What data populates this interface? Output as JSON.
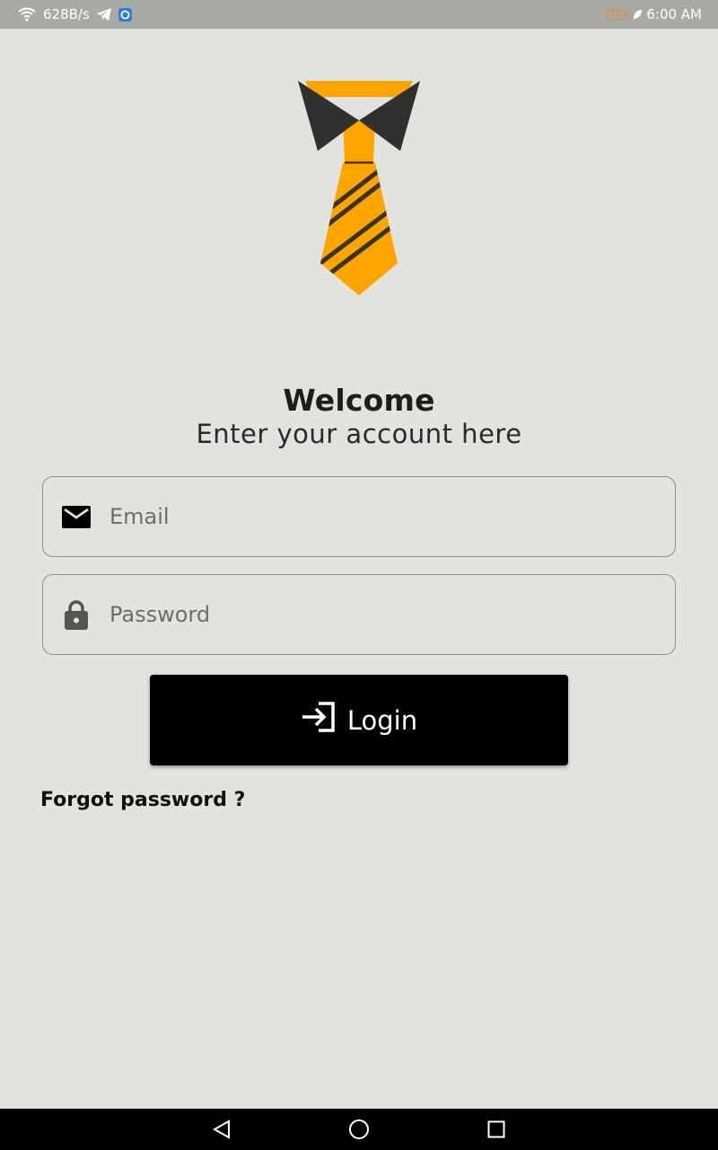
{
  "status_bar": {
    "net_speed": "628B/s",
    "battery_level": "18",
    "time": "6:00 AM",
    "icons": [
      "wifi-icon",
      "telegram-icon",
      "app-notification-icon",
      "battery-icon",
      "charging-leaf-icon"
    ]
  },
  "logo": {
    "icon": "necktie-logo",
    "colors": {
      "tie": "#ffa500",
      "collar": "#2e312d",
      "stripe": "#3a3322"
    }
  },
  "welcome": {
    "title": "Welcome",
    "subtitle": "Enter your account here"
  },
  "form": {
    "email": {
      "placeholder": "Email",
      "value": "",
      "icon": "mail-icon"
    },
    "password": {
      "placeholder": "Password",
      "value": "",
      "icon": "lock-icon"
    },
    "login_label": "Login",
    "login_icon": "login-arrow-icon",
    "forgot_label": "Forgot password ?"
  },
  "nav_bar": {
    "buttons": [
      "back-icon",
      "home-icon",
      "recents-icon"
    ]
  },
  "colors": {
    "background": "#e1e3de",
    "button": "#000000",
    "accent": "#ffa500"
  }
}
